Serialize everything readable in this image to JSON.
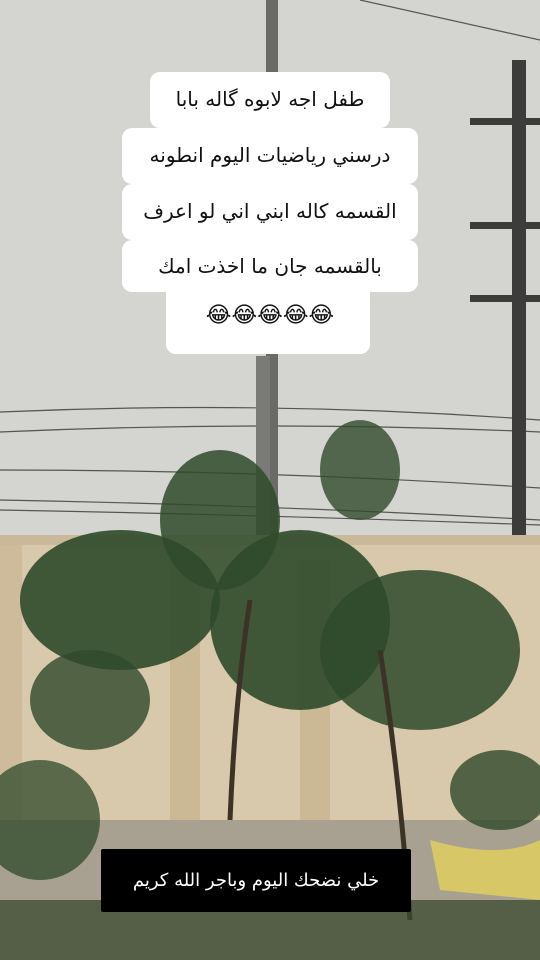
{
  "caption": {
    "lines": [
      "طفل اجه لابوه گاله بابا",
      "درسني رياضيات اليوم انطونه",
      "القسمه كاله ابني اني لو اعرف",
      "بالقسمه جان ما اخذت امك",
      "😂😂😂😂😂"
    ]
  },
  "footer": {
    "label": "خلي نضحك اليوم وباجر الله كريم"
  },
  "colors": {
    "sky": "#d3d3d0",
    "wall": "#d9c9ae",
    "foliage": "#2f4a2a",
    "ground": "#a79f90"
  }
}
